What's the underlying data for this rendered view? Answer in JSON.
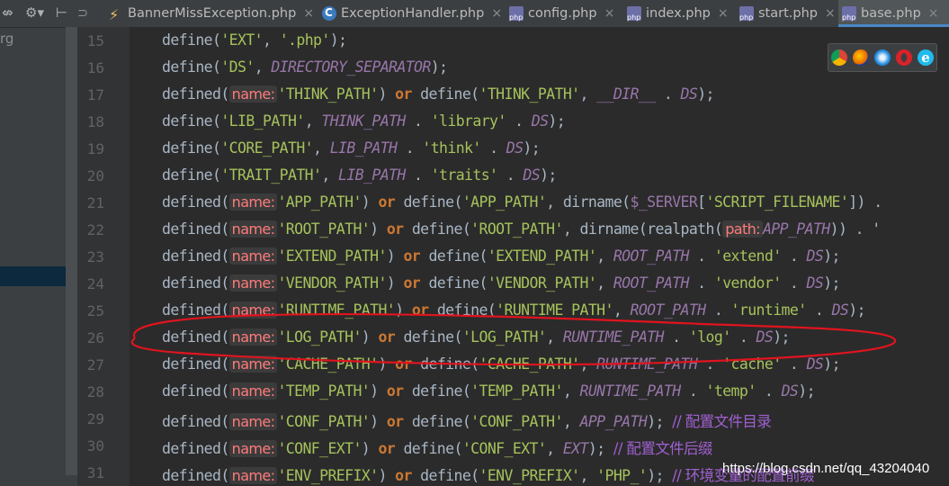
{
  "left_panel": {
    "toolbar_icons": [
      "split-icon",
      "gear-icon",
      "collapse-icon"
    ],
    "tree_text": "rg"
  },
  "tabs": [
    {
      "label": "BannerMissException.php",
      "icon": "exception-icon",
      "active": false
    },
    {
      "label": "ExceptionHandler.php",
      "icon": "class-icon",
      "active": false
    },
    {
      "label": "config.php",
      "icon": "php-icon",
      "active": false
    },
    {
      "label": "index.php",
      "icon": "php-icon",
      "active": false
    },
    {
      "label": "start.php",
      "icon": "php-icon",
      "active": false
    },
    {
      "label": "base.php",
      "icon": "php-icon",
      "active": true
    }
  ],
  "tab_close_glyph": "×",
  "line_numbers": [
    "15",
    "16",
    "17",
    "18",
    "19",
    "20",
    "21",
    "22",
    "23",
    "24",
    "25",
    "26",
    "27",
    "28",
    "29",
    "30",
    "31"
  ],
  "code": {
    "l15": {
      "a": "define(",
      "b": "'EXT'",
      "c": ", ",
      "d": "'.php'",
      "e": ");"
    },
    "l16": {
      "a": "define(",
      "b": "'DS'",
      "c": ", ",
      "d": "DIRECTORY_SEPARATOR",
      "e": ");"
    },
    "l17": {
      "a": "defined(",
      "hint": "name:",
      "b": "'THINK_PATH'",
      "c": ") ",
      "or": "or",
      "d": " define(",
      "e": "'THINK_PATH'",
      "f": ", ",
      "g": "__DIR__",
      "h": " . ",
      "i": "DS",
      "j": ");"
    },
    "l18": {
      "a": "define(",
      "b": "'LIB_PATH'",
      "c": ", ",
      "d": "THINK_PATH",
      "e": " . ",
      "f": "'library'",
      "g": " . ",
      "h": "DS",
      "i": ");"
    },
    "l19": {
      "a": "define(",
      "b": "'CORE_PATH'",
      "c": ", ",
      "d": "LIB_PATH",
      "e": " . ",
      "f": "'think'",
      "g": " . ",
      "h": "DS",
      "i": ");"
    },
    "l20": {
      "a": "define(",
      "b": "'TRAIT_PATH'",
      "c": ", ",
      "d": "LIB_PATH",
      "e": " . ",
      "f": "'traits'",
      "g": " . ",
      "h": "DS",
      "i": ");"
    },
    "l21": {
      "a": "defined(",
      "hint": "name:",
      "b": "'APP_PATH'",
      "c": ") ",
      "or": "or",
      "d": " define(",
      "e": "'APP_PATH'",
      "f": ", dirname(",
      "g": "$_SERVER",
      "h": "[",
      "i": "'SCRIPT_FILENAME'",
      "j": "]) ."
    },
    "l22": {
      "a": "defined(",
      "hint": "name:",
      "b": "'ROOT_PATH'",
      "c": ") ",
      "or": "or",
      "d": " define(",
      "e": "'ROOT_PATH'",
      "f": ", dirname(realpath(",
      "hint2": "path:",
      "g": "APP_PATH",
      "h": ")) . '"
    },
    "l23": {
      "a": "defined(",
      "hint": "name:",
      "b": "'EXTEND_PATH'",
      "c": ") ",
      "or": "or",
      "d": " define(",
      "e": "'EXTEND_PATH'",
      "f": ", ",
      "g": "ROOT_PATH",
      "h": " . ",
      "i": "'extend'",
      "j": " . ",
      "k": "DS",
      "l": ");"
    },
    "l24": {
      "a": "defined(",
      "hint": "name:",
      "b": "'VENDOR_PATH'",
      "c": ") ",
      "or": "or",
      "d": " define(",
      "e": "'VENDOR_PATH'",
      "f": ", ",
      "g": "ROOT_PATH",
      "h": " . ",
      "i": "'vendor'",
      "j": " . ",
      "k": "DS",
      "l": ");"
    },
    "l25": {
      "a": "defined(",
      "hint": "name:",
      "b": "'RUNTIME_PATH'",
      "c": ") ",
      "or": "or",
      "d": " define(",
      "e": "'RUNTIME_PATH'",
      "f": ", ",
      "g": "ROOT_PATH",
      "h": " . ",
      "i": "'runtime'",
      "j": " . ",
      "k": "DS",
      "l": ");"
    },
    "l26": {
      "a": "defined(",
      "hint": "name:",
      "b": "'LOG_PATH'",
      "c": ") ",
      "or": "or",
      "d": " define(",
      "e": "'LOG_PATH'",
      "f": ", ",
      "g": "RUNTIME_PATH",
      "h": " . ",
      "i": "'log'",
      "j": " . ",
      "k": "DS",
      "l": ");"
    },
    "l27": {
      "a": "defined(",
      "hint": "name:",
      "b": "'CACHE_PATH'",
      "c": ") ",
      "or": "or",
      "d": " define(",
      "e": "'CACHE_PATH'",
      "f": ", ",
      "g": "RUNTIME_PATH",
      "h": " . ",
      "i": "'cache'",
      "j": " . ",
      "k": "DS",
      "l": ");"
    },
    "l28": {
      "a": "defined(",
      "hint": "name:",
      "b": "'TEMP_PATH'",
      "c": ") ",
      "or": "or",
      "d": " define(",
      "e": "'TEMP_PATH'",
      "f": ", ",
      "g": "RUNTIME_PATH",
      "h": " . ",
      "i": "'temp'",
      "j": " . ",
      "k": "DS",
      "l": ");"
    },
    "l29": {
      "a": "defined(",
      "hint": "name:",
      "b": "'CONF_PATH'",
      "c": ") ",
      "or": "or",
      "d": " define(",
      "e": "'CONF_PATH'",
      "f": ", ",
      "g": "APP_PATH",
      "h": "); ",
      "cm": "// 配置文件目录"
    },
    "l30": {
      "a": "defined(",
      "hint": "name:",
      "b": "'CONF_EXT'",
      "c": ") ",
      "or": "or",
      "d": " define(",
      "e": "'CONF_EXT'",
      "f": ", ",
      "g": "EXT",
      "h": "); ",
      "cm": "// 配置文件后缀"
    },
    "l31": {
      "a": "defined(",
      "hint": "name:",
      "b": "'ENV_PREFIX'",
      "c": ") ",
      "or": "or",
      "d": " define(",
      "e": "'ENV_PREFIX'",
      "f": ", ",
      "g": "'PHP_'",
      "h": "); ",
      "cm": "// 环境变量的配置前缀"
    }
  },
  "browsers": [
    "chrome-icon",
    "firefox-icon",
    "safari-icon",
    "opera-icon",
    "ie-icon"
  ],
  "watermark": "https://blog.csdn.net/qq_43204040",
  "colors": {
    "annotation": "#e0141e",
    "active_tab_underline": "#4a88c7"
  }
}
